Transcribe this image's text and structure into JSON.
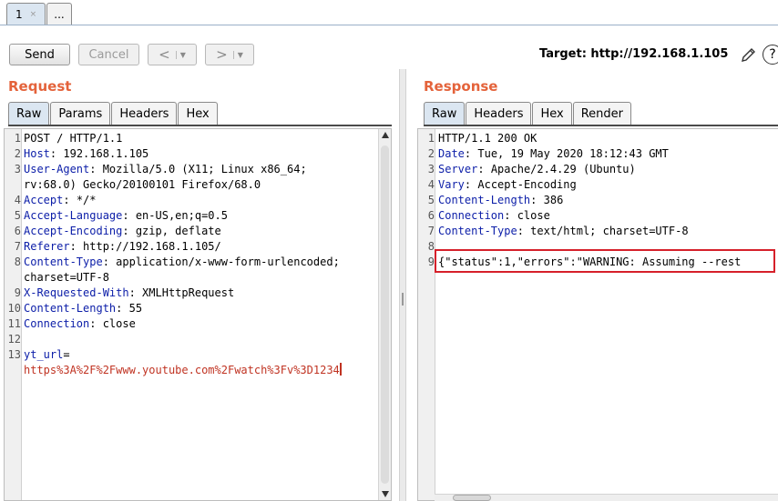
{
  "tabs": [
    {
      "label": "1",
      "close": "×"
    },
    {
      "label": "..."
    }
  ],
  "toolbar": {
    "send": "Send",
    "cancel": "Cancel",
    "back": "<",
    "forward": ">",
    "dropdown": "▼",
    "target": "Target: http://192.168.1.105",
    "help": "?"
  },
  "request": {
    "title": "Request",
    "tabs": [
      "Raw",
      "Params",
      "Headers",
      "Hex"
    ],
    "lines": [
      {
        "n": "1",
        "text": "POST / HTTP/1.1"
      },
      {
        "n": "2",
        "key": "Host",
        "val": " 192.168.1.105"
      },
      {
        "n": "3",
        "key": "User-Agent",
        "val": " Mozilla/5.0 (X11; Linux x86_64;"
      },
      {
        "n": "",
        "text": "rv:68.0) Gecko/20100101 Firefox/68.0"
      },
      {
        "n": "4",
        "key": "Accept",
        "val": " */*"
      },
      {
        "n": "5",
        "key": "Accept-Language",
        "val": " en-US,en;q=0.5"
      },
      {
        "n": "6",
        "key": "Accept-Encoding",
        "val": " gzip, deflate"
      },
      {
        "n": "7",
        "key": "Referer",
        "val": " http://192.168.1.105/"
      },
      {
        "n": "8",
        "key": "Content-Type",
        "val": " application/x-www-form-urlencoded;"
      },
      {
        "n": "",
        "text": "charset=UTF-8"
      },
      {
        "n": "9",
        "key": "X-Requested-With",
        "val": " XMLHttpRequest"
      },
      {
        "n": "10",
        "key": "Content-Length",
        "val": " 55"
      },
      {
        "n": "11",
        "key": "Connection",
        "val": " close"
      },
      {
        "n": "12",
        "text": ""
      },
      {
        "n": "13",
        "param": "yt_url",
        "eq": "="
      },
      {
        "n": "",
        "value": "https%3A%2F%2Fwww.youtube.com%2Fwatch%3Fv%3D1234"
      }
    ]
  },
  "response": {
    "title": "Response",
    "tabs": [
      "Raw",
      "Headers",
      "Hex",
      "Render"
    ],
    "lines": [
      {
        "n": "1",
        "text": "HTTP/1.1 200 OK"
      },
      {
        "n": "2",
        "key": "Date",
        "val": " Tue, 19 May 2020 18:12:43 GMT"
      },
      {
        "n": "3",
        "key": "Server",
        "val": " Apache/2.4.29 (Ubuntu)"
      },
      {
        "n": "4",
        "key": "Vary",
        "val": " Accept-Encoding"
      },
      {
        "n": "5",
        "key": "Content-Length",
        "val": " 386"
      },
      {
        "n": "6",
        "key": "Connection",
        "val": " close"
      },
      {
        "n": "7",
        "key": "Content-Type",
        "val": " text/html; charset=UTF-8"
      },
      {
        "n": "8",
        "text": ""
      },
      {
        "n": "9",
        "text": "{\"status\":1,\"errors\":\"WARNING: Assuming --rest"
      }
    ]
  },
  "colors": {
    "title": "#e4633b",
    "header_key": "#0b1da8",
    "param_value": "#c03322",
    "highlight_border": "#d6202a"
  }
}
